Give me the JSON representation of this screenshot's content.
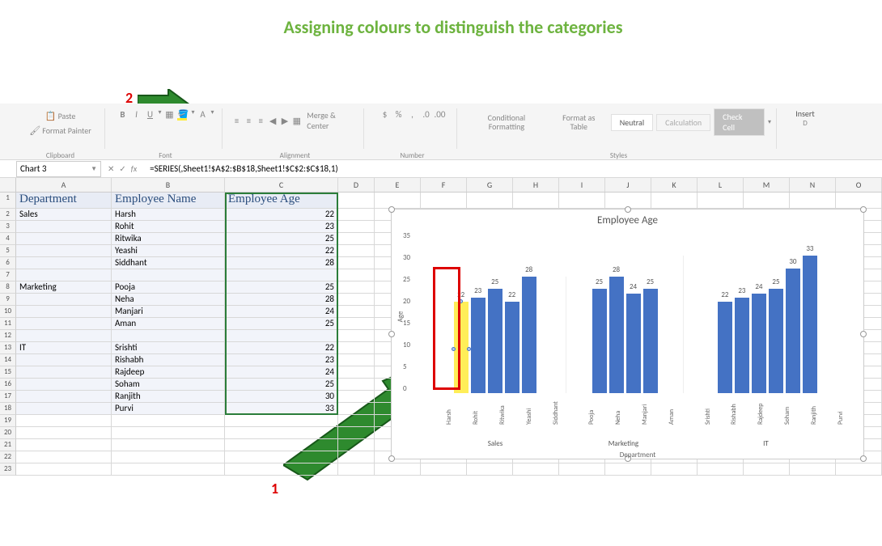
{
  "title": "Assigning colours to distinguish the categories",
  "annotations": {
    "a1": "1",
    "a2": "2"
  },
  "ribbon": {
    "paste": "Paste",
    "format_painter": "Format Painter",
    "merge": "Merge & Center",
    "conditional": "Conditional Formatting",
    "format_as": "Format as Table",
    "neutral": "Neutral",
    "calc": "Calculation",
    "check": "Check Cell",
    "insert": "Insert",
    "groups": {
      "clipboard": "Clipboard",
      "font": "Font",
      "alignment": "Alignment",
      "number": "Number",
      "styles": "Styles"
    }
  },
  "namebox": "Chart 3",
  "formula": "=SERIES(,Sheet1!$A$2:$B$18,Sheet1!$C$2:$C$18,1)",
  "fx_label": "fx",
  "col_headers": [
    "A",
    "B",
    "C",
    "D",
    "E",
    "F",
    "G",
    "H",
    "I",
    "J",
    "K",
    "L",
    "M",
    "N",
    "O"
  ],
  "headers": {
    "dept": "Department",
    "emp": "Employee Name",
    "age": "Employee Age"
  },
  "table": [
    {
      "r": 2,
      "dept": "Sales",
      "name": "Harsh",
      "age": 22
    },
    {
      "r": 3,
      "dept": "",
      "name": "Rohit",
      "age": 23
    },
    {
      "r": 4,
      "dept": "",
      "name": "Ritwika",
      "age": 25
    },
    {
      "r": 5,
      "dept": "",
      "name": "Yeashi",
      "age": 22
    },
    {
      "r": 6,
      "dept": "",
      "name": "Siddhant",
      "age": 28
    },
    {
      "r": 7,
      "dept": "",
      "name": "",
      "age": ""
    },
    {
      "r": 8,
      "dept": "Marketing",
      "name": "Pooja",
      "age": 25
    },
    {
      "r": 9,
      "dept": "",
      "name": "Neha",
      "age": 28
    },
    {
      "r": 10,
      "dept": "",
      "name": "Manjari",
      "age": 24
    },
    {
      "r": 11,
      "dept": "",
      "name": "Aman",
      "age": 25
    },
    {
      "r": 12,
      "dept": "",
      "name": "",
      "age": ""
    },
    {
      "r": 13,
      "dept": "IT",
      "name": "Srishti",
      "age": 22
    },
    {
      "r": 14,
      "dept": "",
      "name": "Rishabh",
      "age": 23
    },
    {
      "r": 15,
      "dept": "",
      "name": "Rajdeep",
      "age": 24
    },
    {
      "r": 16,
      "dept": "",
      "name": "Soham",
      "age": 25
    },
    {
      "r": 17,
      "dept": "",
      "name": "Ranjith",
      "age": 30
    },
    {
      "r": 18,
      "dept": "",
      "name": "Purvi",
      "age": 33
    }
  ],
  "empty_rows": [
    19,
    20,
    21,
    22,
    23
  ],
  "chart_data": {
    "type": "bar",
    "title": "Employee Age",
    "ylabel": "Age",
    "xlabel": "Department",
    "ylim": [
      0,
      35
    ],
    "yticks": [
      35,
      30,
      25,
      20,
      15,
      10,
      5,
      0
    ],
    "groups": [
      {
        "dept": "Sales",
        "bars": [
          {
            "name": "Harsh",
            "val": 22,
            "selected": true
          },
          {
            "name": "Rohit",
            "val": 23
          },
          {
            "name": "Ritwika",
            "val": 25
          },
          {
            "name": "Yeashi",
            "val": 22
          },
          {
            "name": "Siddhant",
            "val": 28
          }
        ]
      },
      {
        "dept": "Marketing",
        "bars": [
          {
            "name": "Pooja",
            "val": 25
          },
          {
            "name": "Neha",
            "val": 28
          },
          {
            "name": "Manjari",
            "val": 24
          },
          {
            "name": "Aman",
            "val": 25
          }
        ]
      },
      {
        "dept": "IT",
        "bars": [
          {
            "name": "Srishti",
            "val": 22
          },
          {
            "name": "Rishabh",
            "val": 23
          },
          {
            "name": "Rajdeep",
            "val": 24
          },
          {
            "name": "Soham",
            "val": 25
          },
          {
            "name": "Ranjith",
            "val": 30
          },
          {
            "name": "Purvi",
            "val": 33
          }
        ]
      }
    ]
  }
}
